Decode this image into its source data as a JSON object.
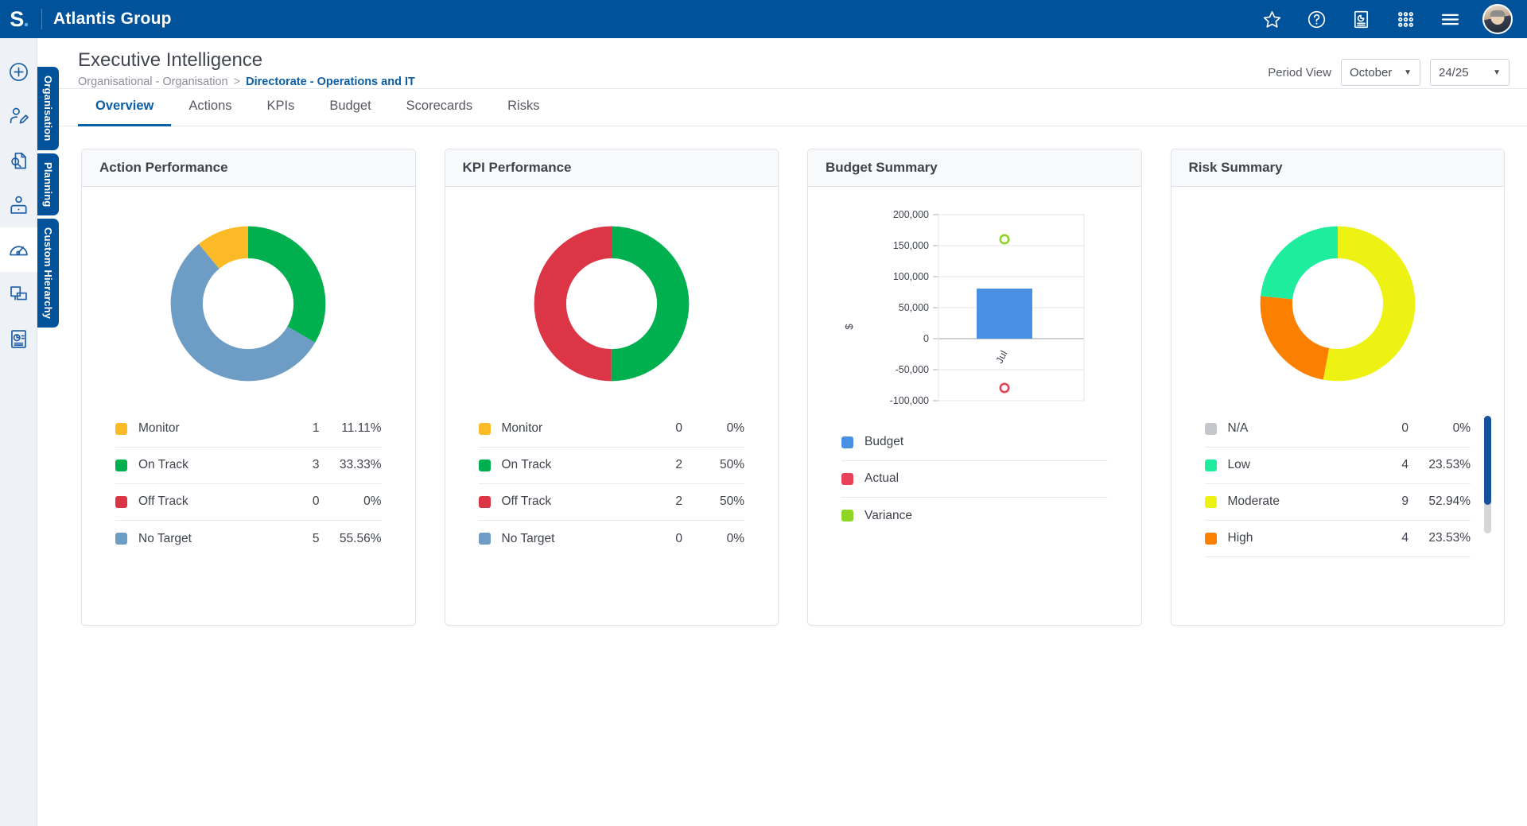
{
  "topbar": {
    "logo_text": "S",
    "logo_dot": ".",
    "org_name": "Atlantis Group",
    "icons": [
      {
        "name": "star-icon",
        "glyph": "star"
      },
      {
        "name": "help-icon",
        "glyph": "question"
      },
      {
        "name": "report-icon",
        "glyph": "report"
      },
      {
        "name": "apps-grid-icon",
        "glyph": "grid"
      },
      {
        "name": "hamburger-menu-icon",
        "glyph": "menu"
      }
    ],
    "avatar_name": "user-avatar"
  },
  "rail": {
    "items": [
      {
        "name": "add-icon",
        "label": "Add"
      },
      {
        "name": "edit-user-icon",
        "label": "Edit User"
      },
      {
        "name": "document-search-icon",
        "label": "Document Search"
      },
      {
        "name": "user-desk-icon",
        "label": "User Desk"
      },
      {
        "name": "gauge-icon",
        "label": "Dashboard",
        "active": true
      },
      {
        "name": "layers-icon",
        "label": "Layers"
      },
      {
        "name": "report-page-icon",
        "label": "Reports"
      }
    ]
  },
  "vertical_tabs": [
    {
      "name": "vtab-organisation",
      "label": "Organisation"
    },
    {
      "name": "vtab-planning",
      "label": "Planning"
    },
    {
      "name": "vtab-custom-hierarchy",
      "label": "Custom Hierarchy"
    }
  ],
  "header": {
    "title": "Executive Intelligence",
    "breadcrumb_root": "Organisational - Organisation",
    "breadcrumb_sep": ">",
    "breadcrumb_current": "Directorate - Operations and IT"
  },
  "period": {
    "label": "Period View",
    "month_value": "October",
    "year_value": "24/25",
    "caret": "▼"
  },
  "tabs": [
    {
      "label": "Overview",
      "active": true
    },
    {
      "label": "Actions",
      "active": false
    },
    {
      "label": "KPIs",
      "active": false
    },
    {
      "label": "Budget",
      "active": false
    },
    {
      "label": "Scorecards",
      "active": false
    },
    {
      "label": "Risks",
      "active": false
    }
  ],
  "cards": {
    "action": {
      "title": "Action Performance"
    },
    "kpi": {
      "title": "KPI Performance"
    },
    "budget": {
      "title": "Budget Summary"
    },
    "risk": {
      "title": "Risk Summary"
    }
  },
  "chart_data": [
    {
      "type": "pie",
      "title": "Action Performance",
      "categories": [
        "Monitor",
        "On Track",
        "Off Track",
        "No Target"
      ],
      "values": [
        1,
        3,
        0,
        5
      ],
      "percents": [
        "11.11%",
        "33.33%",
        "0%",
        "55.56%"
      ],
      "colors": [
        "#fcbb26",
        "#00b04f",
        "#dc3545",
        "#6d9dc5"
      ],
      "legend": "bottom",
      "donut": true
    },
    {
      "type": "pie",
      "title": "KPI Performance",
      "categories": [
        "Monitor",
        "On Track",
        "Off Track",
        "No Target"
      ],
      "values": [
        0,
        2,
        2,
        0
      ],
      "percents": [
        "0%",
        "50%",
        "50%",
        "0%"
      ],
      "colors": [
        "#fcbb26",
        "#00b04f",
        "#dc3545",
        "#6d9dc5"
      ],
      "legend": "bottom",
      "donut": true
    },
    {
      "type": "bar",
      "title": "Budget Summary",
      "categories": [
        "Jul"
      ],
      "series": [
        {
          "name": "Budget",
          "values": [
            80000
          ],
          "color": "#4a90e2",
          "mark": "bar"
        },
        {
          "name": "Actual",
          "values": [
            -80000
          ],
          "color": "#e8415a",
          "mark": "circle"
        },
        {
          "name": "Variance",
          "values": [
            160000
          ],
          "color": "#8fd624",
          "mark": "circle"
        }
      ],
      "ylabel": "$",
      "xlabel": "",
      "ylim": [
        -100000,
        200000
      ],
      "yticks": [
        "200,000",
        "150,000",
        "100,000",
        "50,000",
        "0",
        "-50,000",
        "-100,000"
      ],
      "grid": true,
      "legend": "bottom"
    },
    {
      "type": "pie",
      "title": "Risk Summary",
      "categories": [
        "N/A",
        "Low",
        "Moderate",
        "High"
      ],
      "values": [
        0,
        4,
        9,
        4
      ],
      "percents": [
        "0%",
        "23.53%",
        "52.94%",
        "23.53%"
      ],
      "colors": [
        "#c4c7cb",
        "#1ded9d",
        "#eef213",
        "#fb8000"
      ],
      "legend": "bottom",
      "donut": true
    }
  ]
}
